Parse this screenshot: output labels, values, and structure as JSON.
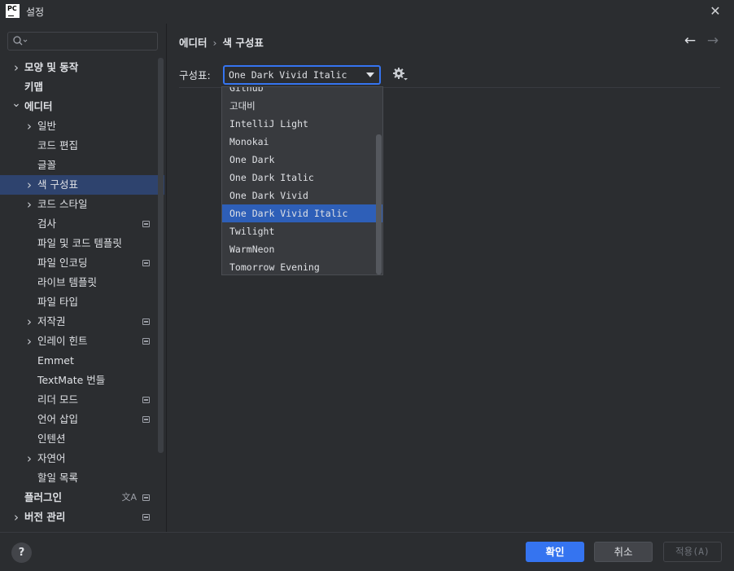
{
  "window": {
    "title": "설정",
    "logo": "PC"
  },
  "search": {
    "placeholder": ""
  },
  "sidebar": {
    "items": [
      {
        "label": "모양 및 동작",
        "level": 0,
        "chevron": "right",
        "bold": true
      },
      {
        "label": "키맵",
        "level": 0,
        "chevron": "",
        "bold": true
      },
      {
        "label": "에디터",
        "level": 0,
        "chevron": "down",
        "bold": true
      },
      {
        "label": "일반",
        "level": 1,
        "chevron": "right"
      },
      {
        "label": "코드 편집",
        "level": 1,
        "chevron": ""
      },
      {
        "label": "글꼴",
        "level": 1,
        "chevron": ""
      },
      {
        "label": "색 구성표",
        "level": 1,
        "chevron": "right",
        "selected": true
      },
      {
        "label": "코드 스타일",
        "level": 1,
        "chevron": "right"
      },
      {
        "label": "검사",
        "level": 1,
        "chevron": "",
        "badge": true
      },
      {
        "label": "파일 및 코드 템플릿",
        "level": 1,
        "chevron": ""
      },
      {
        "label": "파일 인코딩",
        "level": 1,
        "chevron": "",
        "badge": true
      },
      {
        "label": "라이브 템플릿",
        "level": 1,
        "chevron": ""
      },
      {
        "label": "파일 타입",
        "level": 1,
        "chevron": ""
      },
      {
        "label": "저작권",
        "level": 1,
        "chevron": "right",
        "badge": true
      },
      {
        "label": "인레이 힌트",
        "level": 1,
        "chevron": "right",
        "badge": true
      },
      {
        "label": "Emmet",
        "level": 1,
        "chevron": ""
      },
      {
        "label": "TextMate 번들",
        "level": 1,
        "chevron": ""
      },
      {
        "label": "리더 모드",
        "level": 1,
        "chevron": "",
        "badge": true
      },
      {
        "label": "언어 삽입",
        "level": 1,
        "chevron": "",
        "badge": true
      },
      {
        "label": "인텐션",
        "level": 1,
        "chevron": ""
      },
      {
        "label": "자연어",
        "level": 1,
        "chevron": "right"
      },
      {
        "label": "할일 목록",
        "level": 1,
        "chevron": ""
      },
      {
        "label": "플러그인",
        "level": 0,
        "chevron": "",
        "bold": true,
        "badge": true,
        "translate": true
      },
      {
        "label": "버전 관리",
        "level": 0,
        "chevron": "right",
        "bold": true,
        "badge": true
      }
    ]
  },
  "main": {
    "breadcrumb": {
      "parent": "에디터",
      "separator": "›",
      "current": "색 구성표"
    },
    "scheme": {
      "label": "구성표:",
      "value": "One Dark Vivid Italic"
    },
    "dropdown": {
      "items": [
        "Github",
        "고대비",
        "IntelliJ Light",
        "Monokai",
        "One Dark",
        "One Dark Italic",
        "One Dark Vivid",
        "One Dark Vivid Italic",
        "Twilight",
        "WarmNeon",
        "Tomorrow Evening"
      ],
      "selected_index": 7
    }
  },
  "footer": {
    "help": "?",
    "ok": "확인",
    "cancel": "취소",
    "apply": "적용(A)"
  },
  "icons": {
    "translate": "文A"
  },
  "colors": {
    "accent": "#3574f0",
    "selection": "#2e436e",
    "background": "#2b2d30"
  }
}
